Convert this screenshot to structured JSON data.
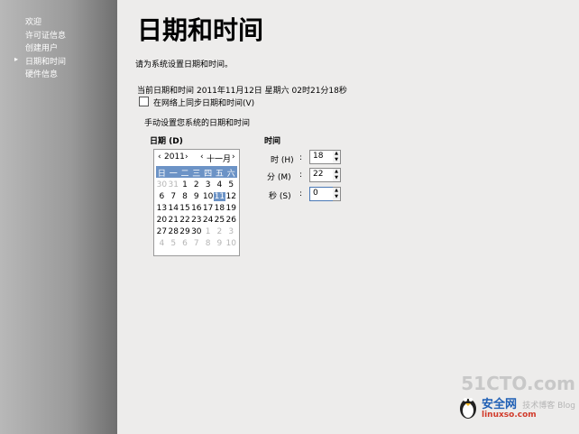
{
  "sidebar": {
    "items": [
      {
        "label": "欢迎"
      },
      {
        "label": "许可证信息"
      },
      {
        "label": "创建用户"
      },
      {
        "label": "日期和时间"
      },
      {
        "label": "硬件信息"
      }
    ],
    "active_index": 3
  },
  "page": {
    "title": "日期和时间",
    "subtitle": "请为系统设置日期和时间。",
    "current_label": "当前日期和时间",
    "current_value": "2011年11月12日 星期六 02时21分18秒",
    "ntp_checkbox_label": "在网络上同步日期和时间",
    "ntp_checkbox_mnemonic": "(V)",
    "ntp_checked": false,
    "manual_label": "手动设置您系统的日期和时间"
  },
  "date": {
    "section_label": "日期",
    "section_mnemonic": "(D)",
    "year": "2011",
    "month": "十一月",
    "prev_year": "‹",
    "next_year": "›",
    "prev_month": "‹",
    "next_month": "›",
    "weekdays": [
      "日",
      "一",
      "二",
      "三",
      "四",
      "五",
      "六"
    ],
    "rows": [
      [
        "30",
        "31",
        "1",
        "2",
        "3",
        "4",
        "5"
      ],
      [
        "6",
        "7",
        "8",
        "9",
        "10",
        "11",
        "12"
      ],
      [
        "13",
        "14",
        "15",
        "16",
        "17",
        "18",
        "19"
      ],
      [
        "20",
        "21",
        "22",
        "23",
        "24",
        "25",
        "26"
      ],
      [
        "27",
        "28",
        "29",
        "30",
        "1",
        "2",
        "3"
      ],
      [
        "4",
        "5",
        "6",
        "7",
        "8",
        "9",
        "10"
      ]
    ],
    "selected_day": "11"
  },
  "time": {
    "section_label": "时间",
    "hour_label": "时",
    "hour_mnemonic": "(H)",
    "hour_value": "18",
    "minute_label": "分",
    "minute_mnemonic": "(M)",
    "minute_value": "22",
    "second_label": "秒",
    "second_mnemonic": "(S)",
    "second_value": "0",
    "colon": ":"
  },
  "watermark": {
    "line1": "51CTO.com",
    "line2": "安全网",
    "line3": "linuxso.com",
    "line4": "技术博客 Blog"
  },
  "icons": {
    "sidebar_active": "triangle-right-icon",
    "spin_up": "up-arrow-icon",
    "spin_down": "down-arrow-icon"
  },
  "colors": {
    "accent": "#6c93c6",
    "background": "#edeceb"
  }
}
